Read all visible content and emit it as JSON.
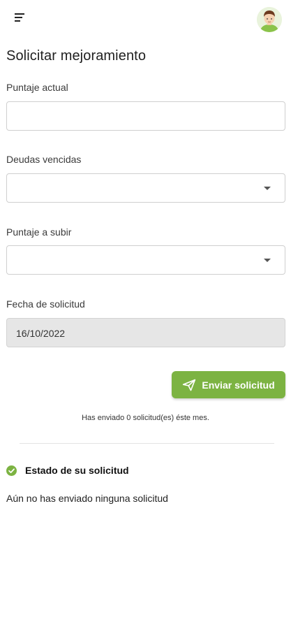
{
  "colors": {
    "accent": "#7cb342",
    "disabled_field_bg": "#e6e6e6",
    "border": "#cfcfcf"
  },
  "header": {
    "menu_icon": "menu-icon",
    "avatar_icon": "user-avatar"
  },
  "page": {
    "title": "Solicitar mejoramiento"
  },
  "form": {
    "current_score": {
      "label": "Puntaje actual",
      "value": ""
    },
    "overdue_debts": {
      "label": "Deudas vencidas",
      "selected": ""
    },
    "score_to_raise": {
      "label": "Puntaje a subir",
      "selected": ""
    },
    "request_date": {
      "label": "Fecha de solicitud",
      "value": "16/10/2022"
    },
    "submit_label": "Enviar solicitud",
    "submit_icon": "send-icon"
  },
  "sent_info": "Has enviado 0 solicitud(es) éste mes.",
  "status": {
    "icon": "check-circle-icon",
    "title": "Estado de su solicitud",
    "message": "Aún no has enviado ninguna solicitud"
  }
}
